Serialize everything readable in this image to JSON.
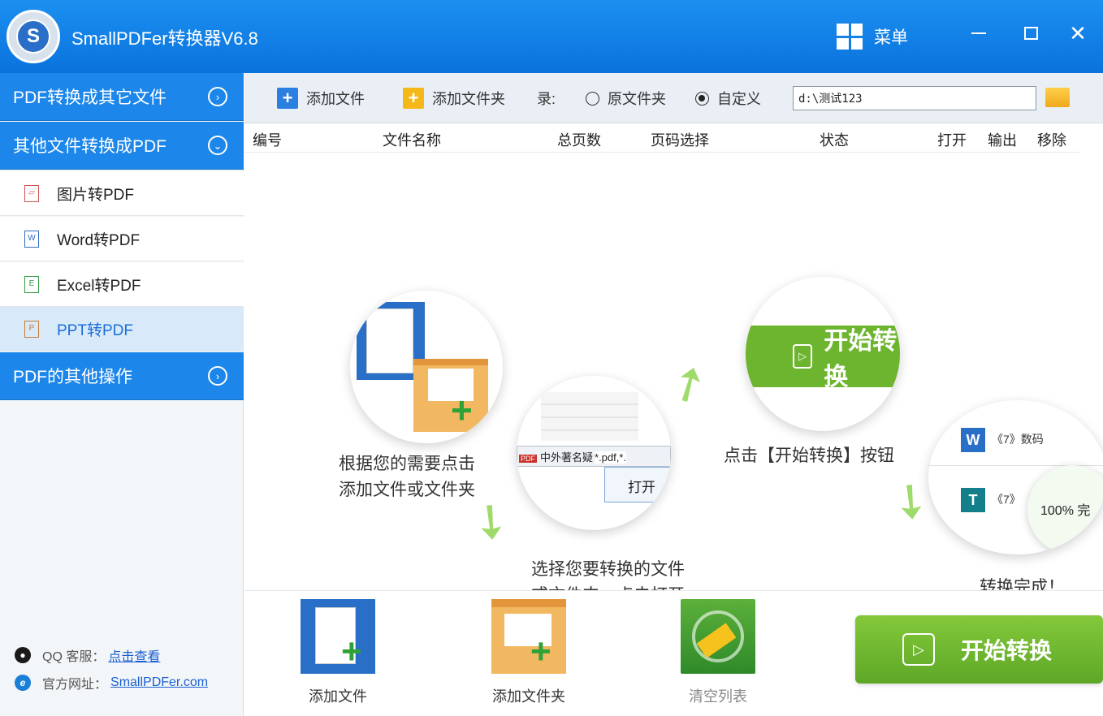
{
  "window": {
    "title": "SmallPDFer转换器V6.8",
    "menu_label": "菜单",
    "logo_letter": "S"
  },
  "sidebar": {
    "categories": [
      {
        "label": "PDF转换成其它文件"
      },
      {
        "label": "其他文件转换成PDF"
      },
      {
        "label": "PDF的其他操作"
      }
    ],
    "items": [
      {
        "label": "图片转PDF"
      },
      {
        "label": "Word转PDF"
      },
      {
        "label": "Excel转PDF"
      },
      {
        "label": "PPT转PDF"
      }
    ],
    "contact": {
      "qq_label": "QQ 客服：",
      "qq_link": "点击查看",
      "site_label": "官方网址：",
      "site_link": "SmallPDFer.com"
    }
  },
  "toolbar": {
    "add_file": "添加文件",
    "add_folder": "添加文件夹",
    "dir_label": "录:",
    "radio_original": "原文件夹",
    "radio_custom": "自定义",
    "selected_radio": "自定义",
    "output_path": "d:\\测试123"
  },
  "table": {
    "columns": [
      "编号",
      "文件名称",
      "总页数",
      "页码选择",
      "状态",
      "打开",
      "输出",
      "移除"
    ]
  },
  "guide": {
    "step1": "根据您的需要点击",
    "step1b": "添加文件或文件夹",
    "step2": "选择您要转换的文件",
    "step2b": "或文件夹，点击打开",
    "step3": "点击【开始转换】按钮",
    "step4": "转换完成！",
    "pic_start_button": "开始转换",
    "pic_file_dialog_name": "中外著名疑",
    "pic_file_dialog_filter": "*.pdf,*.",
    "pic_open_button": "打开",
    "pic_doc1": "《7》数码",
    "pic_doc2": "《7》",
    "pic_progress": "100%",
    "pic_progress_suffix": "完"
  },
  "bottom": {
    "add_file": "添加文件",
    "add_folder": "添加文件夹",
    "clear_list": "清空列表",
    "start": "开始转换"
  },
  "colors": {
    "title_bar": "#1284ea",
    "accent_blue": "#1c86ea",
    "start_green": "#6db52f"
  }
}
